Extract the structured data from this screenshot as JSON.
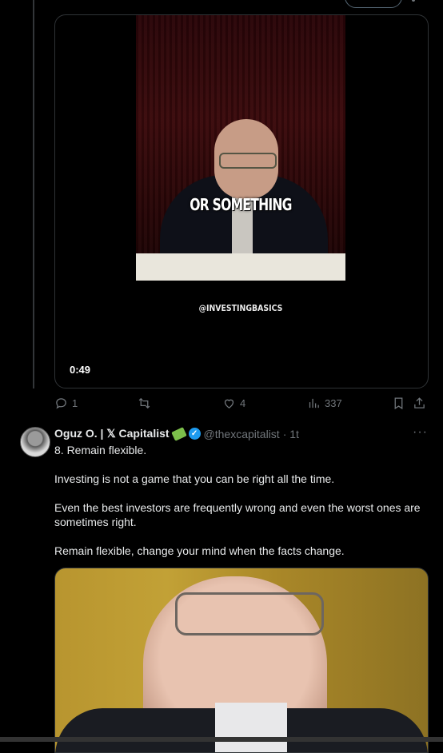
{
  "video": {
    "caption": "OR SOMETHING",
    "watermark": "@INVESTINGBASICS",
    "duration": "0:49"
  },
  "actions": {
    "reply_count": "1",
    "like_count": "4",
    "views_count": "337",
    "icons": [
      "reply-icon",
      "retweet-icon",
      "like-icon",
      "views-icon",
      "bookmark-icon",
      "share-icon"
    ]
  },
  "tweet": {
    "author_name": "Oguz O. | 𝕏 Capitalist",
    "handle": "@thexcapitalist",
    "time": "· 1t",
    "more": "···",
    "paragraphs": [
      "8. Remain flexible.",
      "Investing is not a game that you can be right all the time.",
      "Even the best investors are frequently wrong and even the worst ones are sometimes right.",
      "Remain flexible, change your mind when the facts change."
    ]
  },
  "colors": {
    "background": "#000000",
    "text": "#e7e9ea",
    "muted": "#71767b",
    "verified": "#1d9bf0",
    "border": "#2f3336"
  }
}
